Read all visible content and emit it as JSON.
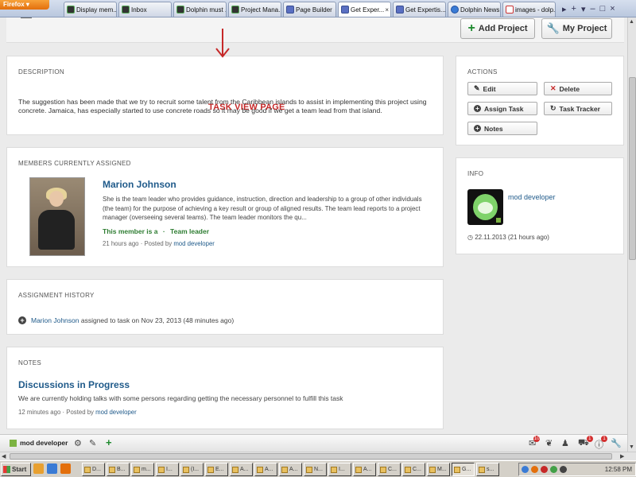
{
  "browser": {
    "firefox_label": "Firefox",
    "tabs": [
      {
        "label": "Display mem...",
        "favicon": "dolphin-icon",
        "active": false
      },
      {
        "label": "Inbox",
        "favicon": "dolphin-icon",
        "active": false
      },
      {
        "label": "Dolphin must ...",
        "favicon": "dolphin-icon",
        "active": false
      },
      {
        "label": "Project Mana...",
        "favicon": "dolphin-icon",
        "active": false
      },
      {
        "label": "Page Builder",
        "favicon": "page-builder-icon",
        "active": false
      },
      {
        "label": "Get Exper...",
        "favicon": "page-builder-icon",
        "active": true,
        "close": "×"
      },
      {
        "label": "Get Expertis...",
        "favicon": "page-builder-icon",
        "active": false
      },
      {
        "label": "Dolphin News...",
        "favicon": "dolphin-news-icon",
        "active": false
      },
      {
        "label": "images - dolp...",
        "favicon": "gmail-icon",
        "active": false
      }
    ]
  },
  "header": {
    "add_project": "Add Project",
    "my_project": "My Project"
  },
  "annotation": {
    "label": "TASK VIEW PAGE",
    "color": "#c62828"
  },
  "description": {
    "heading": "DESCRIPTION",
    "text": "The suggestion has been made that we try to recruit some talent from the Caribbean islands to assist in implementing this project using concrete. Jamaica, has especially started to use concrete roads so it may be good if we get a team lead from that island."
  },
  "members": {
    "heading": "MEMBERS CURRENTLY ASSIGNED",
    "member": {
      "name": "Marion Johnson",
      "bio": "She is the team leader who provides guidance, instruction, direction and leadership to a group of other individuals (the team) for the purpose of achieving a key result or group of aligned results. The team lead reports to a project manager (overseeing several teams). The team leader monitors the qu...",
      "role_prefix": "This member is a",
      "role_sep": "·",
      "role": "Team leader",
      "time": "21 hours ago",
      "posted_by": "· Posted by",
      "author": "mod developer"
    }
  },
  "history": {
    "heading": "ASSIGNMENT HISTORY",
    "entry_user": "Marion Johnson",
    "entry_text": "assigned to task",
    "entry_on": "on Nov 23, 2013 (48 minutes ago)"
  },
  "notes": {
    "heading": "NOTES",
    "title": "Discussions in Progress",
    "text": "We are currently holding talks with some persons regarding getting the necessary personnel to fulfill this task",
    "time": "12 minutes ago",
    "posted_by": "· Posted by",
    "author": "mod developer"
  },
  "actions": {
    "heading": "ACTIONS",
    "edit": "Edit",
    "delete": "Delete",
    "assign_task": "Assign Task",
    "task_tracker": "Task Tracker",
    "notes": "Notes"
  },
  "info": {
    "heading": "INFO",
    "user": "mod developer",
    "date": "22.11.2013 (21 hours ago)"
  },
  "footer": {
    "user": "mod developer",
    "badges": {
      "mail": "10",
      "cart": "1",
      "alert": "1"
    }
  },
  "taskbar": {
    "start": "Start",
    "items": [
      "D...",
      "B...",
      "m...",
      "I...",
      "(I...",
      "E...",
      "A...",
      "A...",
      "A...",
      "N...",
      "I...",
      "A...",
      "C...",
      "C...",
      "M...",
      "G...",
      "s..."
    ],
    "clock": "12:58 PM"
  }
}
